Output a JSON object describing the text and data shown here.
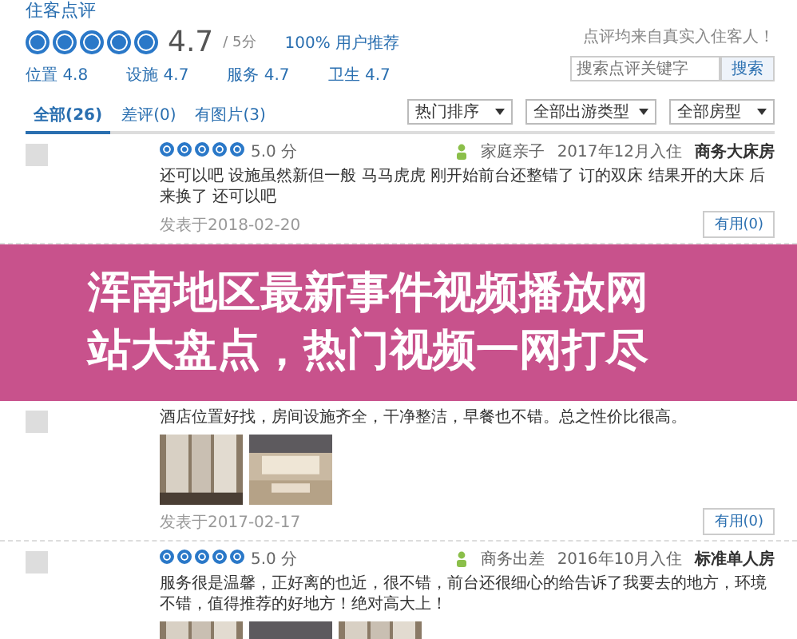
{
  "header": {
    "title": "住客点评",
    "stars": 5,
    "score": "4.7",
    "score_unit": "/ 5分",
    "recommend": "100% 用户推荐",
    "note": "点评均来自真实入住客人！"
  },
  "sub_scores": [
    {
      "label": "位置",
      "value": "4.8"
    },
    {
      "label": "设施",
      "value": "4.7"
    },
    {
      "label": "服务",
      "value": "4.7"
    },
    {
      "label": "卫生",
      "value": "4.7"
    }
  ],
  "search": {
    "placeholder": "搜索点评关键字",
    "button": "搜索"
  },
  "tabs": [
    {
      "label": "全部(26)",
      "selected": true
    },
    {
      "label": "差评(0)",
      "selected": false
    },
    {
      "label": "有图片(3)",
      "selected": false
    }
  ],
  "filters": [
    "热门排序",
    "全部出游类型",
    "全部房型"
  ],
  "reviews": [
    {
      "stars": 5,
      "score": "5.0 分",
      "user": "家庭亲子",
      "stay": "2017年12月入住",
      "room": "商务大床房",
      "text": "还可以吧 设施虽然新但一般 马马虎虎 刚开始前台还整错了 订的双床 结果开的大床 后来换了 还可以吧",
      "posted": "发表于2018-02-20",
      "useful": "有用(0)"
    },
    {
      "text": "酒店位置好找，房间设施齐全，干净整洁，早餐也不错。总之性价比很高。",
      "photos": [
        {
          "kind": "picture"
        },
        {
          "kind": "picture"
        }
      ],
      "posted": "发表于2017-02-17",
      "useful": "有用(0)"
    },
    {
      "stars": 5,
      "score": "5.0 分",
      "user": "商务出差",
      "stay": "2016年10月入住",
      "room": "标准单人房",
      "text": "服务很是温馨，正好离的也近，很不错，前台还很细心的给告诉了我要去的地方，环境不错，值得推荐的好地方！绝对高大上！",
      "photos": [
        {
          "kind": "picture"
        },
        {
          "kind": "picture"
        },
        {
          "kind": "picture"
        }
      ]
    }
  ],
  "overlay": {
    "lines": [
      "浑南地区最新事件视频播放网",
      "站大盘点，热门视频一网打尽"
    ]
  }
}
